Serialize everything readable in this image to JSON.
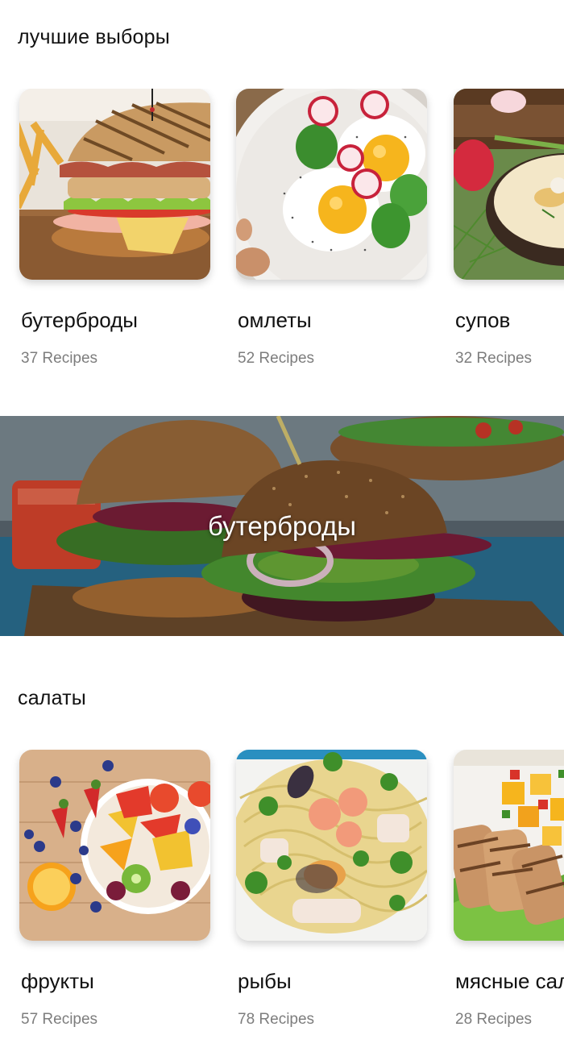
{
  "sections": [
    {
      "title": "лучшие выборы",
      "cards": [
        {
          "title": "бутерброды",
          "count": "37 Recipes",
          "image": "club-sandwich-photo"
        },
        {
          "title": "омлеты",
          "count": "52 Recipes",
          "image": "fried-eggs-photo"
        },
        {
          "title": "супов",
          "count": "32 Recipes",
          "image": "soup-bowl-photo"
        }
      ]
    },
    {
      "title": "салаты",
      "cards": [
        {
          "title": "фрукты",
          "count": "57 Recipes",
          "image": "fruit-salad-photo"
        },
        {
          "title": "рыбы",
          "count": "78 Recipes",
          "image": "seafood-pasta-photo"
        },
        {
          "title": "мясные салаты",
          "count": "28 Recipes",
          "image": "meat-salad-photo"
        }
      ]
    }
  ],
  "banner": {
    "label": "бутерброды",
    "image": "burgers-photo"
  }
}
